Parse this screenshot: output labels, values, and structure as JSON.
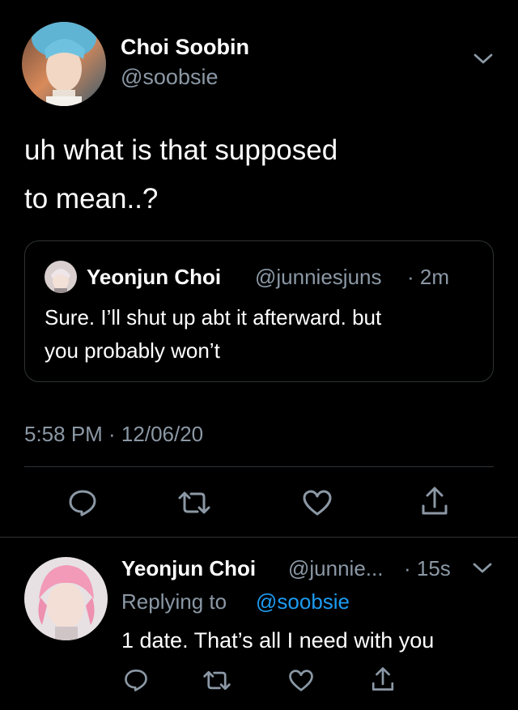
{
  "main_tweet": {
    "author_name": "Choi Soobin",
    "author_handle": "@soobsie",
    "text_line1": "uh what is that supposed",
    "text_line2": "to mean..?",
    "timestamp": "5:58 PM · 12/06/20"
  },
  "quoted_tweet": {
    "author_name": "Yeonjun Choi",
    "author_handle": "@junniesjuns",
    "time": "· 2m",
    "text_line1": "Sure. I’ll shut up abt it afterward. but",
    "text_line2": "you probably won’t"
  },
  "reply": {
    "author_name": "Yeonjun Choi",
    "author_handle": "@junnie...",
    "time": "· 15s",
    "replying_prefix": "Replying to",
    "replying_handle": "@soobsie",
    "text": "1 date. That’s all I need with you"
  },
  "icons": {
    "reply": "reply-icon",
    "retweet": "retweet-icon",
    "like": "heart-icon",
    "share": "share-icon",
    "more": "chevron-down-icon"
  },
  "colors": {
    "background": "#000000",
    "text": "#e7e9ea",
    "muted": "#8b98a5",
    "link": "#1d9bf0",
    "border": "#2f3336"
  }
}
